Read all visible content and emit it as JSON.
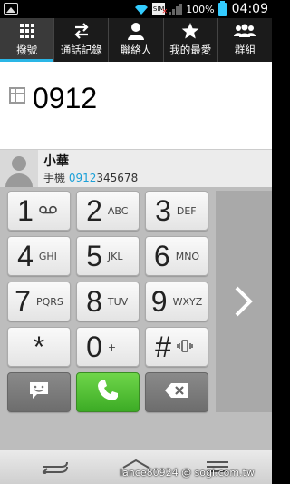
{
  "status_bar": {
    "battery_percent": "100%",
    "time": "04:09",
    "icons": [
      "image-notification-icon",
      "wifi-icon",
      "no-sim-icon",
      "signal-icon",
      "battery-icon"
    ]
  },
  "tabs": [
    {
      "label": "撥號",
      "icon": "dialpad-icon",
      "active": true
    },
    {
      "label": "通話記錄",
      "icon": "call-log-icon",
      "active": false
    },
    {
      "label": "聯絡人",
      "icon": "contact-icon",
      "active": false
    },
    {
      "label": "我的最愛",
      "icon": "star-icon",
      "active": false
    },
    {
      "label": "群組",
      "icon": "group-icon",
      "active": false
    }
  ],
  "display": {
    "number": "0912"
  },
  "suggestion": {
    "name": "小華",
    "label": "手機",
    "number_match": "0912",
    "number_rest": "345678"
  },
  "keypad": {
    "keys": [
      {
        "digit": "1",
        "letters": "voicemail-icon"
      },
      {
        "digit": "2",
        "letters": "ABC"
      },
      {
        "digit": "3",
        "letters": "DEF"
      },
      {
        "digit": "4",
        "letters": "GHI"
      },
      {
        "digit": "5",
        "letters": "JKL"
      },
      {
        "digit": "6",
        "letters": "MNO"
      },
      {
        "digit": "7",
        "letters": "PQRS"
      },
      {
        "digit": "8",
        "letters": "TUV"
      },
      {
        "digit": "9",
        "letters": "WXYZ"
      },
      {
        "digit": "*",
        "letters": ""
      },
      {
        "digit": "0",
        "letters": "+"
      },
      {
        "digit": "#",
        "letters": "vibrate-icon"
      }
    ],
    "bottom": [
      "message-icon",
      "call-icon",
      "backspace-icon"
    ]
  },
  "colors": {
    "accent": "#2ab6e6",
    "call_green": "#4cc22f",
    "match_highlight": "#1aa0d8"
  },
  "watermark": "lance80924 @ sogi.com.tw"
}
